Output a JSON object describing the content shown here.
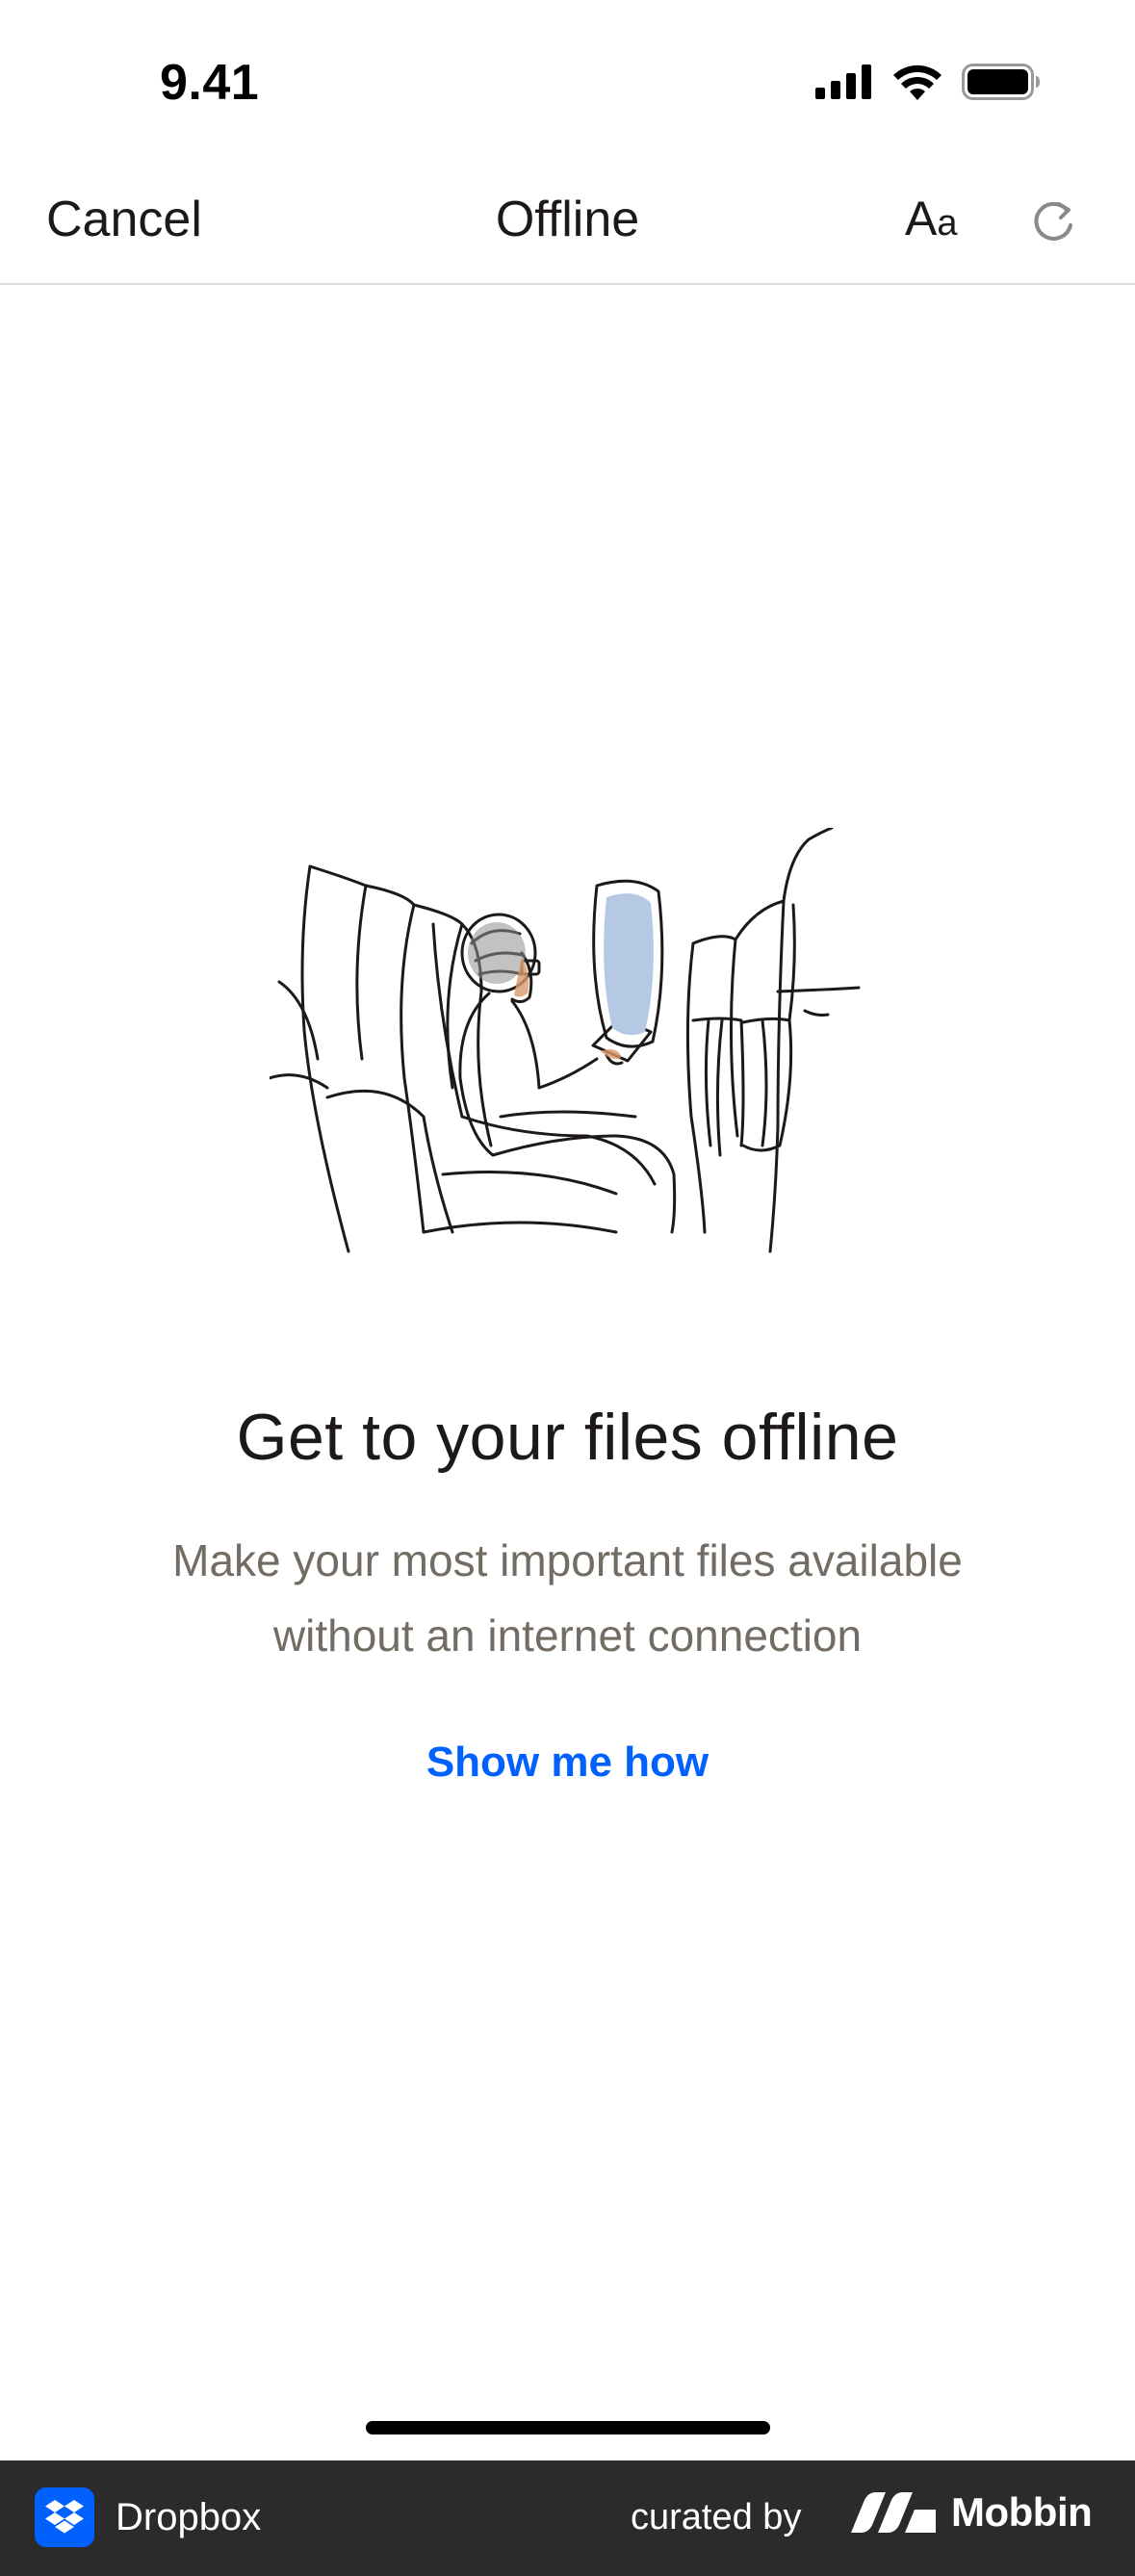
{
  "status_bar": {
    "time": "9.41",
    "icons": [
      "cellular-signal-icon",
      "wifi-icon",
      "battery-icon"
    ]
  },
  "nav": {
    "cancel_label": "Cancel",
    "title": "Offline",
    "font_button_big": "A",
    "font_button_small": "a",
    "refresh_icon": "refresh-icon"
  },
  "empty_state": {
    "illustration": "person-on-airplane-reading-tablet",
    "title": "Get to your files offline",
    "subtitle_line1": "Make your most important files available",
    "subtitle_line2": "without an internet connection",
    "cta_label": "Show me how"
  },
  "footer": {
    "brand_name": "Dropbox",
    "curated_by": "curated by",
    "curator_name": "Mobbin"
  },
  "colors": {
    "accent": "#0061fe",
    "text_primary": "#1e1919",
    "text_secondary": "#736c64",
    "footer_bg": "#2b2b2b",
    "window_tint": "#b5c9e4"
  }
}
